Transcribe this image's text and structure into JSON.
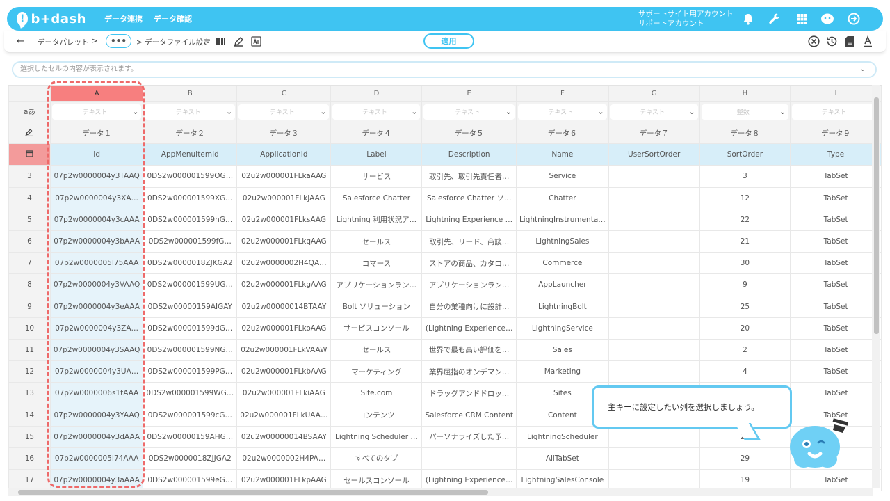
{
  "app": {
    "logo_text": "b+dash",
    "nav": [
      "データ連携",
      "データ確認"
    ],
    "account_line1": "サポートサイト用アカウント",
    "account_line2": "サポートアカウント"
  },
  "toolbar": {
    "crumb1": "データパレット",
    "sep1": ">",
    "more": "•••",
    "crumb2": "> データファイル設定",
    "apply_label": "適用"
  },
  "cellbar": {
    "placeholder": "選択したセルの内容が表示されます。"
  },
  "grid": {
    "type_row_label": "aあ",
    "columns": [
      {
        "letter": "A",
        "type": "テキスト",
        "name": "データ１",
        "header": "Id"
      },
      {
        "letter": "B",
        "type": "テキスト",
        "name": "データ２",
        "header": "AppMenuItemId"
      },
      {
        "letter": "C",
        "type": "テキスト",
        "name": "データ３",
        "header": "ApplicationId"
      },
      {
        "letter": "D",
        "type": "テキスト",
        "name": "データ４",
        "header": "Label"
      },
      {
        "letter": "E",
        "type": "テキスト",
        "name": "データ５",
        "header": "Description"
      },
      {
        "letter": "F",
        "type": "テキスト",
        "name": "データ６",
        "header": "Name"
      },
      {
        "letter": "G",
        "type": "テキスト",
        "name": "データ７",
        "header": "UserSortOrder"
      },
      {
        "letter": "H",
        "type": "整数",
        "name": "データ８",
        "header": "SortOrder"
      },
      {
        "letter": "I",
        "type": "テキスト",
        "name": "データ９",
        "header": "Type"
      }
    ],
    "rows": [
      {
        "num": "3",
        "cells": [
          "07p2w0000004y3TAAQ",
          "0DS2w000001599OG…",
          "02u2w000001FLkaAAG",
          "サービス",
          "取引先、取引先責任者…",
          "Service",
          "",
          "3",
          "TabSet"
        ]
      },
      {
        "num": "4",
        "cells": [
          "07p2w0000004y3XA…",
          "0DS2w000001599XG…",
          "02u2w000001FLkjAAG",
          "Salesforce Chatter",
          "Salesforce Chatter ソ…",
          "Chatter",
          "",
          "12",
          "TabSet"
        ]
      },
      {
        "num": "5",
        "cells": [
          "07p2w0000004y3cAAA",
          "0DS2w000001599hG…",
          "02u2w000001FLksAAG",
          "Lightning 利用状況ア…",
          "Lightning Experience …",
          "LightningInstrumenta…",
          "",
          "22",
          "TabSet"
        ]
      },
      {
        "num": "6",
        "cells": [
          "07p2w0000004y3bAAA",
          "0DS2w000001599fG…",
          "02u2w000001FLkqAAG",
          "セールス",
          "取引先、リード、商談…",
          "LightningSales",
          "",
          "21",
          "TabSet"
        ]
      },
      {
        "num": "7",
        "cells": [
          "07p2w0000005I75AAA",
          "0DS2w0000018ZJKGA2",
          "02u2w0000002H4QA…",
          "コマース",
          "ストアの商品、カタロ…",
          "Commerce",
          "",
          "30",
          "TabSet"
        ]
      },
      {
        "num": "8",
        "cells": [
          "07p2w0000004y3VAAQ",
          "0DS2w000001599UG…",
          "02u2w000001FLkgAAG",
          "アプリケーションラン…",
          "アプリケーションラン…",
          "AppLauncher",
          "",
          "9",
          "TabSet"
        ]
      },
      {
        "num": "9",
        "cells": [
          "07p2w0000004y3eAAA",
          "0DS2w00000159AIGAY",
          "02u2w00000014BTAAY",
          "Bolt ソリューション",
          "自分の業種向けに設計…",
          "LightningBolt",
          "",
          "25",
          "TabSet"
        ]
      },
      {
        "num": "10",
        "cells": [
          "07p2w0000004y3ZA…",
          "0DS2w000001599dG…",
          "02u2w000001FLkoAAG",
          "サービスコンソール",
          "(Lightning Experience…",
          "LightningService",
          "",
          "20",
          "TabSet"
        ]
      },
      {
        "num": "11",
        "cells": [
          "07p2w0000004y3SAAQ",
          "0DS2w000001599NG…",
          "02u2w000001FLkVAAW",
          "セールス",
          "世界で最も高い評価を…",
          "Sales",
          "",
          "2",
          "TabSet"
        ]
      },
      {
        "num": "12",
        "cells": [
          "07p2w0000004y3UA…",
          "0DS2w000001599PG…",
          "02u2w000001FLkbAAG",
          "マーケティング",
          "業界屈指のオンデマン…",
          "Marketing",
          "",
          "4",
          "TabSet"
        ]
      },
      {
        "num": "13",
        "cells": [
          "07p2w0000006s1tAAA",
          "0DS2w000001599WG…",
          "02u2w000001FLkiAAG",
          "Site.com",
          "ドラッグアンドドロッ…",
          "Sites",
          "",
          "",
          "TabSet"
        ]
      },
      {
        "num": "14",
        "cells": [
          "07p2w0000004y3YAAQ",
          "0DS2w000001599cG…",
          "02u2w000001FLkUAA…",
          "コンテンツ",
          "Salesforce CRM Content",
          "Content",
          "",
          "",
          "TabSet"
        ]
      },
      {
        "num": "15",
        "cells": [
          "07p2w0000004y3dAAA",
          "0DS2w00000159AHG…",
          "02u2w00000014BSAAY",
          "Lightning Scheduler …",
          "パーソナライズした予…",
          "LightningScheduler",
          "",
          "24",
          ""
        ]
      },
      {
        "num": "16",
        "cells": [
          "07p2w0000005I74AAA",
          "0DS2w0000018ZJJGA2",
          "02u2w0000002H4PA…",
          "すべてのタブ",
          "",
          "AllTabSet",
          "",
          "29",
          ""
        ]
      },
      {
        "num": "17",
        "cells": [
          "07p2w0000004y3aAAA",
          "0DS2w000001599eG…",
          "02u2w000001FLkpAAG",
          "セールスコンソール",
          "(Lightning Experience…",
          "LightningSalesConsole",
          "",
          "19",
          "TabSet"
        ]
      }
    ]
  },
  "tooltip": {
    "text": "主キーに設定したい列を選択しましょう。"
  },
  "colors": {
    "brand": "#3fc4f2",
    "selected_col": "#f77f7f",
    "key_row": "#d7eef9",
    "dash": "#ee6a6a"
  }
}
